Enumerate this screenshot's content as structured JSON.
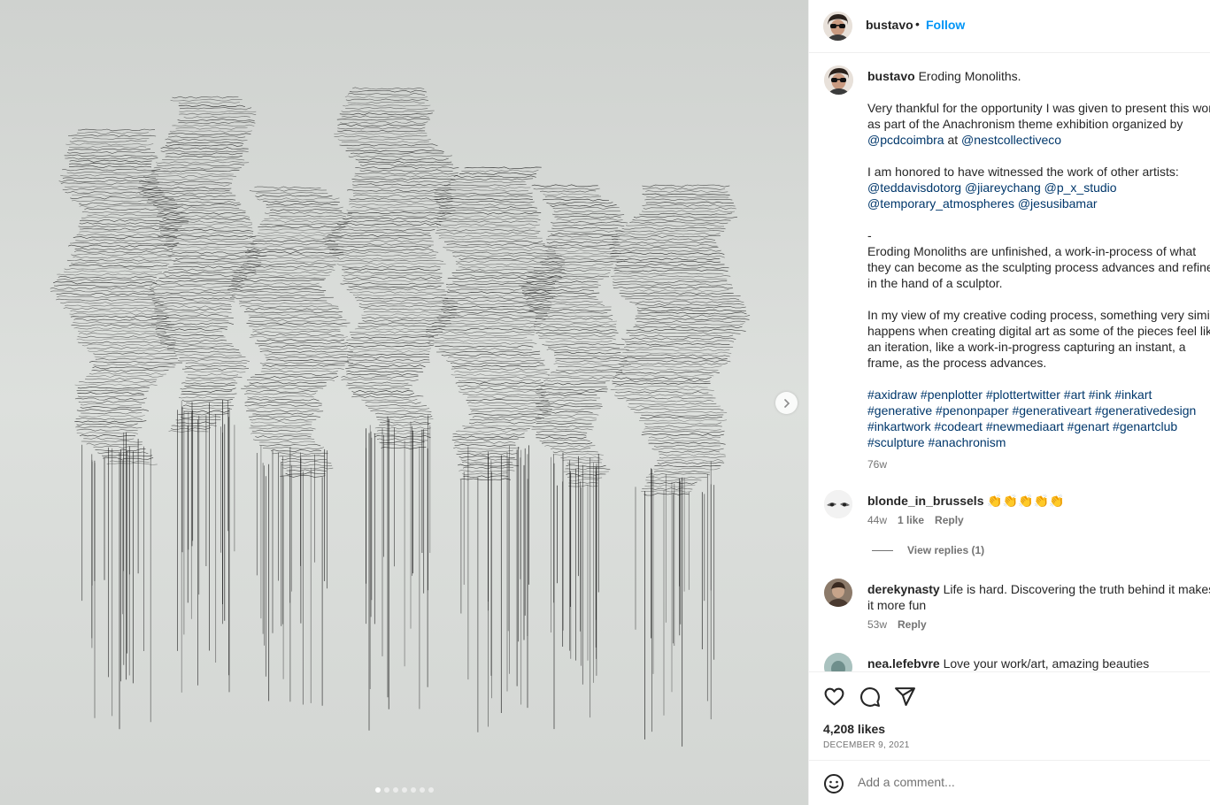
{
  "post": {
    "username": "bustavo",
    "separator": "•",
    "follow_label": "Follow",
    "slide_count": 7,
    "active_slide": 1
  },
  "caption": {
    "username": "bustavo",
    "title": "Eroding Monoliths.",
    "p1_line1": "Very thankful for the opportunity I was given to present this work",
    "p1_line2": "as part of the Anachronism theme exhibition organized by",
    "p1_mention1": "@pcdcoimbra",
    "p1_at": "at",
    "p1_mention2": "@nestcollectiveco",
    "p2_line1": "I am honored to have witnessed the work of other artists:",
    "p2_mentions_a": "@teddavisdotorg @jiareychang @p_x_studio",
    "p2_mentions_b": "@temporary_atmospheres @jesusibamar",
    "dash": "-",
    "p3_line1": "Eroding Monoliths are unfinished, a work-in-process of what",
    "p3_line2": "they can become as the sculpting process advances and refines",
    "p3_line3": "in the hand of a sculptor.",
    "p4_line1": "In my view of my creative coding process, something very similar",
    "p4_line2": "happens when creating digital art as some of the pieces feel like",
    "p4_line3": "an iteration, like a work-in-progress capturing an instant, a",
    "p4_line4": "frame, as the process advances.",
    "tags_line1": "#axidraw #penplotter #plottertwitter #art #ink #inkart",
    "tags_line2": "#generative #penonpaper #generativeart #generativedesign",
    "tags_line3": "#inkartwork #codeart #newmediaart #genart #genartclub",
    "tags_line4": "#sculpture #anachronism",
    "time": "76w"
  },
  "comments": [
    {
      "username": "blonde_in_brussels",
      "text": "👏👏👏👏👏",
      "time": "44w",
      "likes": "1 like",
      "reply": "Reply"
    },
    {
      "username": "derekynasty",
      "text_line1": "Life is hard. Discovering the truth behind it makes",
      "text_line2": "it more fun",
      "time": "53w",
      "reply": "Reply"
    },
    {
      "username": "nea.lefebvre",
      "text": "Love your work/art, amazing beauties"
    }
  ],
  "view_replies": "View replies (1)",
  "footer": {
    "likes": "4,208 likes",
    "date": "DECEMBER 9, 2021",
    "comment_placeholder": "Add a comment..."
  },
  "colors": {
    "link": "#00376b",
    "follow": "#0095f6",
    "muted": "#737373",
    "media_bg": "#d6d9d6"
  },
  "icons": [
    "next-arrow-icon",
    "heart-icon",
    "comment-icon",
    "share-icon",
    "emoji-icon"
  ]
}
